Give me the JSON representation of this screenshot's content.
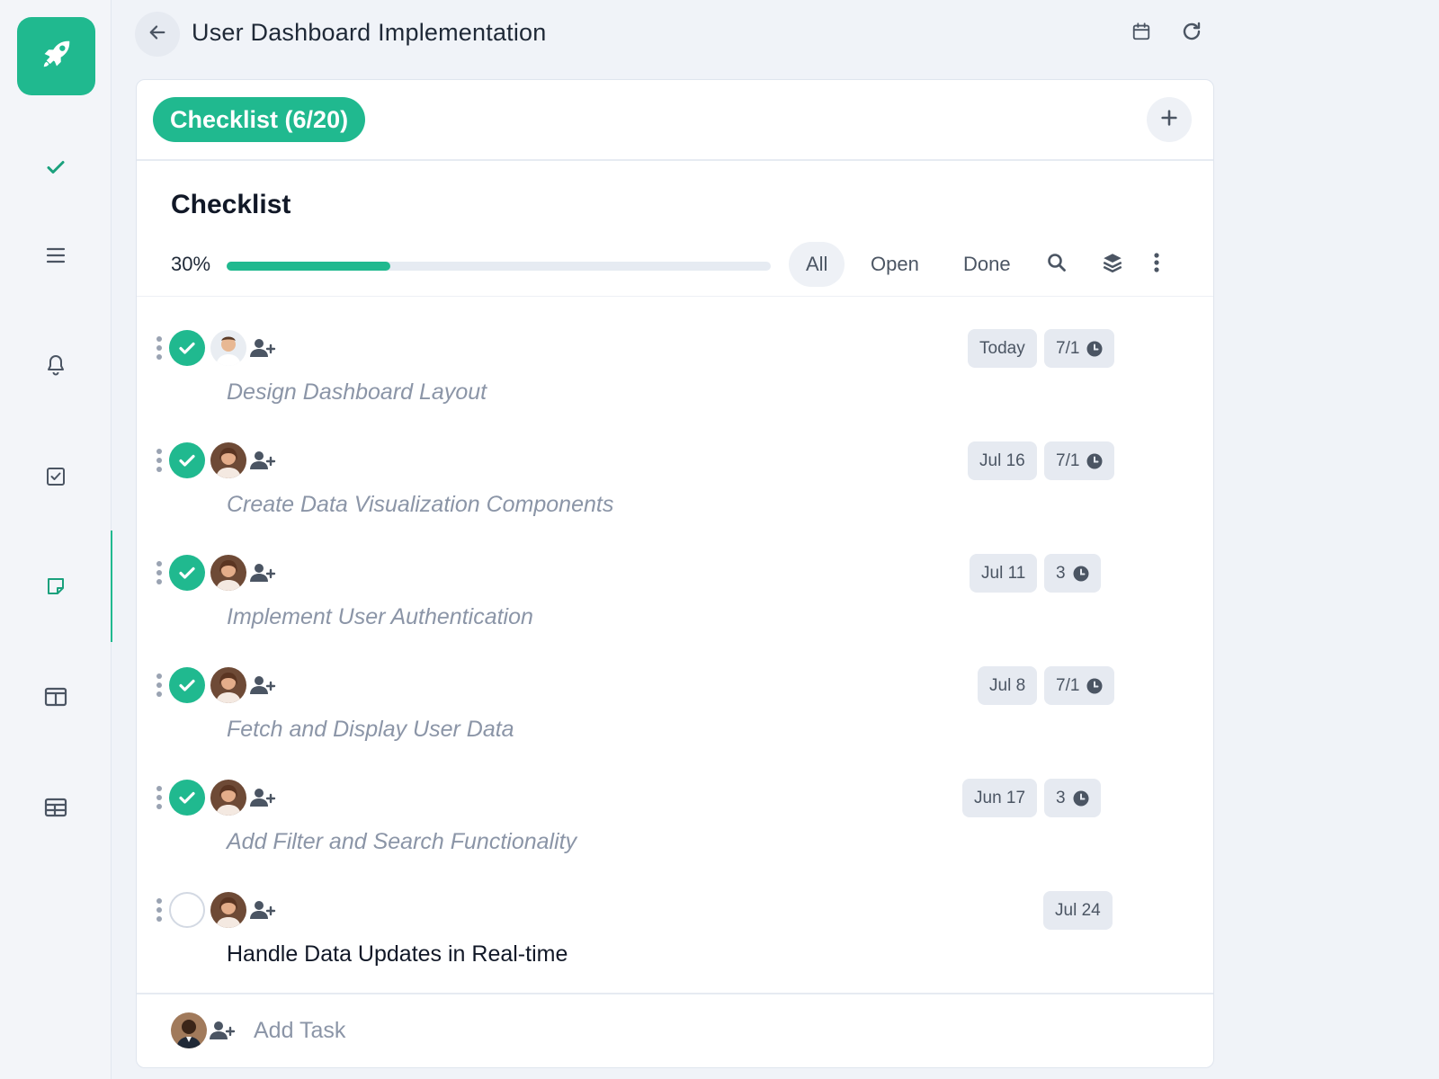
{
  "app": {
    "title": "User Dashboard Implementation",
    "accent_color": "#20b98f"
  },
  "sidebar": {
    "logo_icon": "rocket-icon",
    "items": [
      {
        "icon": "check-icon",
        "active": false
      },
      {
        "icon": "menu-icon",
        "active": false
      },
      {
        "icon": "bell-icon",
        "active": false
      },
      {
        "icon": "checkbox-icon",
        "active": false
      },
      {
        "icon": "note-icon",
        "active": true
      },
      {
        "icon": "columns-icon",
        "active": false
      },
      {
        "icon": "table-icon",
        "active": false
      }
    ]
  },
  "header": {
    "back_icon": "arrow-left-icon",
    "actions": [
      "calendar-icon",
      "refresh-icon"
    ]
  },
  "card": {
    "pill_label": "Checklist (6/20)",
    "add_icon": "plus-icon",
    "section_title": "Checklist",
    "progress": {
      "label": "30%",
      "value": 0.3
    },
    "filters": [
      {
        "label": "All",
        "active": true
      },
      {
        "label": "Open",
        "active": false
      },
      {
        "label": "Done",
        "active": false
      }
    ],
    "tools": [
      "search-icon",
      "layers-icon",
      "more-vertical-icon"
    ]
  },
  "tasks": [
    {
      "name": "Design Dashboard Layout",
      "done": true,
      "date": "Today",
      "estimate": "7/1"
    },
    {
      "name": "Create Data Visualization Components",
      "done": true,
      "date": "Jul 16",
      "estimate": "7/1"
    },
    {
      "name": "Implement User Authentication",
      "done": true,
      "date": "Jul 11",
      "estimate": "3"
    },
    {
      "name": "Fetch and Display User Data",
      "done": true,
      "date": "Jul 8",
      "estimate": "7/1"
    },
    {
      "name": "Add Filter and Search Functionality",
      "done": true,
      "date": "Jun 17",
      "estimate": "3"
    },
    {
      "name": "Handle Data Updates in Real-time",
      "done": false,
      "date": "Jul 24",
      "estimate": ""
    }
  ],
  "add_task": {
    "label": "Add Task"
  }
}
